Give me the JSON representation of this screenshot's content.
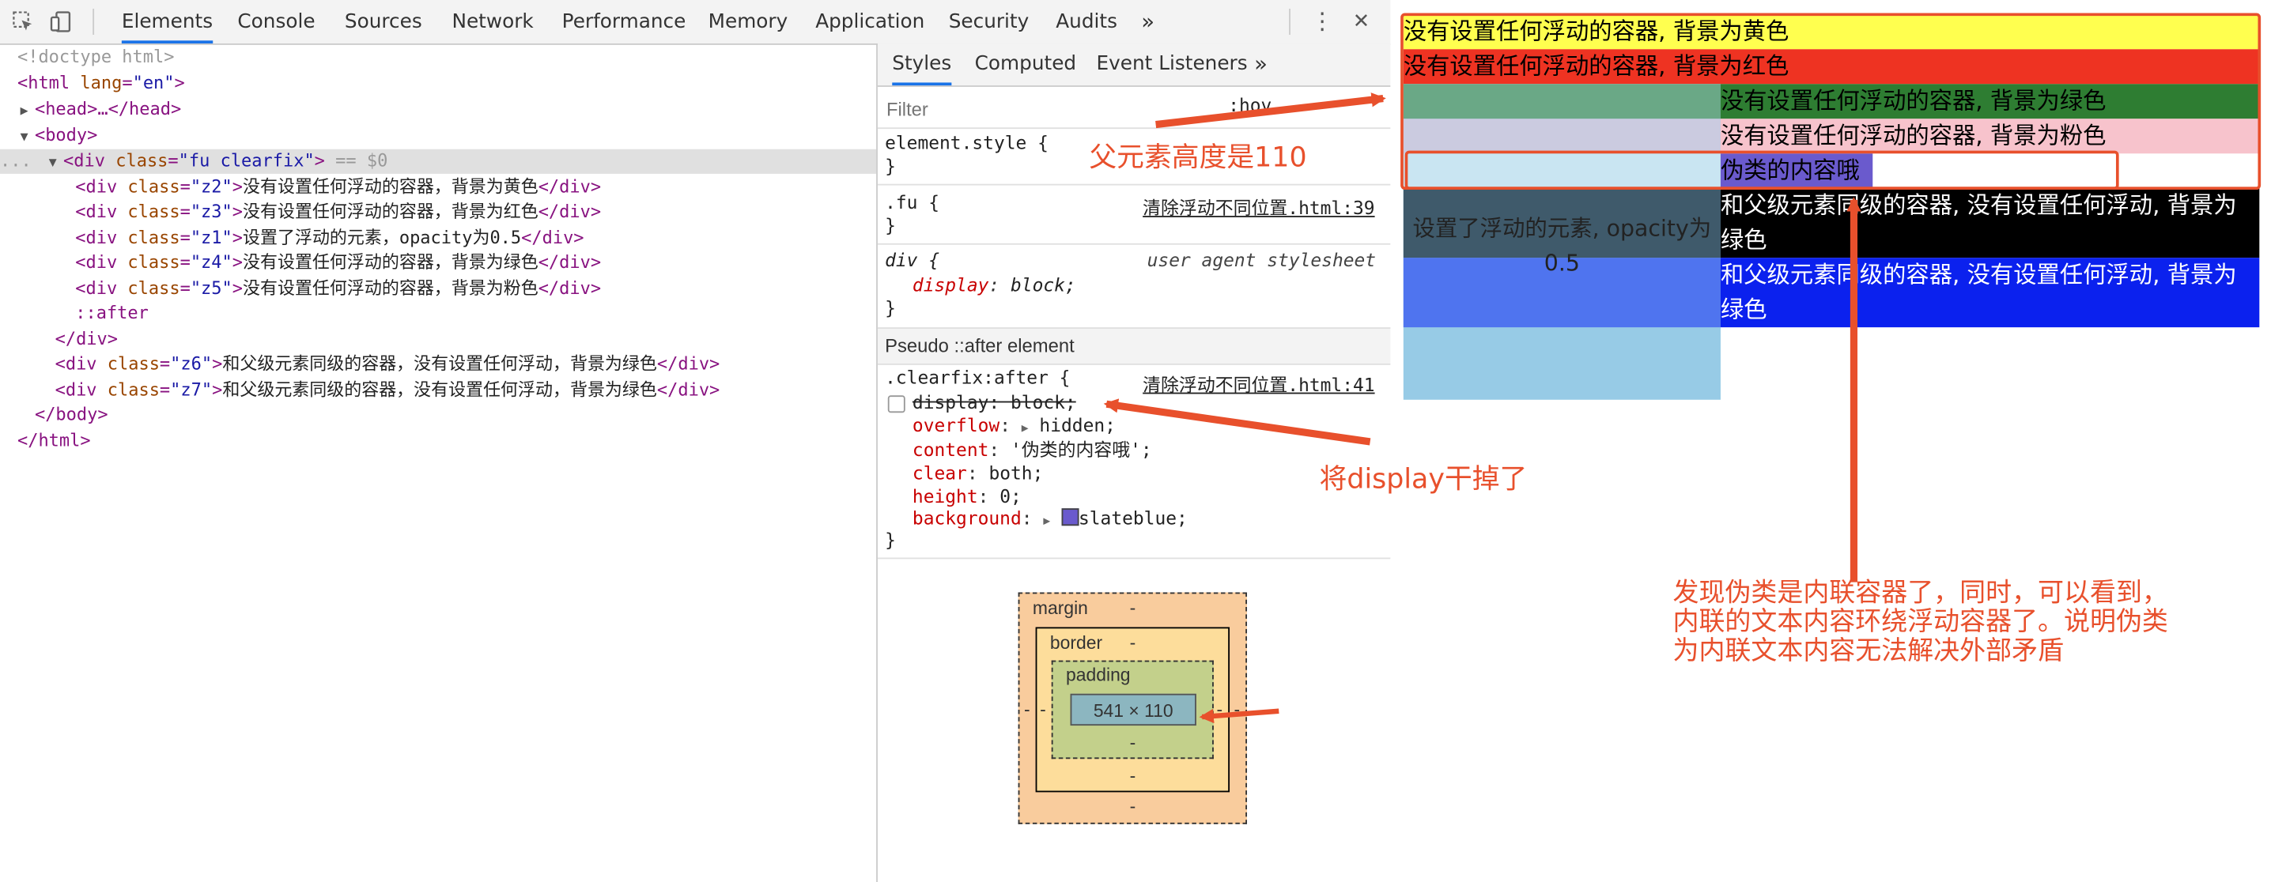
{
  "toolbar": {
    "tabs": [
      "Elements",
      "Console",
      "Sources",
      "Network",
      "Performance",
      "Memory",
      "Application",
      "Security",
      "Audits"
    ],
    "more": "»",
    "menu": "⋮",
    "close": "✕"
  },
  "dom": {
    "doctype": "<!doctype html>",
    "html_open": "<html lang=\"en\">",
    "head": "<head>…</head>",
    "body_open": "<body>",
    "fu_tag": "div",
    "fu_attr": "class",
    "fu_val": "\"fu clearfix\"",
    "fu_marker": "== $0",
    "children": [
      {
        "cls": "\"z2\"",
        "text": "没有设置任何浮动的容器，背景为黄色"
      },
      {
        "cls": "\"z3\"",
        "text": "没有设置任何浮动的容器，背景为红色"
      },
      {
        "cls": "\"z1\"",
        "text": "设置了浮动的元素，opacity为0.5"
      },
      {
        "cls": "\"z4\"",
        "text": "没有设置任何浮动的容器，背景为绿色"
      },
      {
        "cls": "\"z5\"",
        "text": "没有设置任何浮动的容器，背景为粉色"
      }
    ],
    "after": "::after",
    "div_close": "</div>",
    "siblings": [
      {
        "cls": "\"z6\"",
        "text": "和父级元素同级的容器，没有设置任何浮动，背景为绿色"
      },
      {
        "cls": "\"z7\"",
        "text": "和父级元素同级的容器，没有设置任何浮动，背景为绿色"
      }
    ],
    "body_close": "</body>",
    "html_close": "</html>",
    "ellipsis": "..."
  },
  "styles": {
    "tabs": [
      "Styles",
      "Computed",
      "Event Listeners"
    ],
    "more": "»",
    "filter_placeholder": "Filter",
    "hov": ":hov",
    "element_style": "element.style {",
    "close_brace": "}",
    "fu_selector": ".fu {",
    "fu_src": "清除浮动不同位置.html:39",
    "div_selector": "div {",
    "ua": "user agent stylesheet",
    "display_prop": "display",
    "display_val": "block;",
    "pseudo_header": "Pseudo ::after element",
    "clearfix_selector": ".clearfix:after {",
    "clearfix_src": "清除浮动不同位置.html:41",
    "props": [
      {
        "name": "display",
        "value": "block;",
        "struck": true
      },
      {
        "name": "overflow",
        "value": "hidden;"
      },
      {
        "name": "content",
        "value": "'伪类的内容哦';"
      },
      {
        "name": "clear",
        "value": "both;"
      },
      {
        "name": "height",
        "value": "0;"
      },
      {
        "name": "background",
        "value": "slateblue;"
      }
    ],
    "slateblue": "#6a5acd"
  },
  "box_model": {
    "margin_label": "margin",
    "border_label": "border",
    "padding_label": "padding",
    "dash": "-",
    "content_size": "541 × 110"
  },
  "render": {
    "z2": "没有设置任何浮动的容器, 背景为黄色",
    "z3": "没有设置任何浮动的容器, 背景为红色",
    "z4": "没有设置任何浮动的容器, 背景为绿色",
    "z5": "没有设置任何浮动的容器, 背景为粉色",
    "after": "伪类的内容哦",
    "z1": "设置了浮动的元素, opacity为0.5",
    "z6": "和父级元素同级的容器, 没有设置任何浮动, 背景为绿色",
    "z7": "和父级元素同级的容器, 没有设置任何浮动, 背景为绿色",
    "colors": {
      "yellow": "#ffff4f",
      "red": "#ee3322",
      "green": "#2e7d32",
      "pink": "#f7c3cc",
      "black": "#000000",
      "blue": "#0b21ee",
      "float": "#97cbe6",
      "slateblue": "#6a5acd"
    }
  },
  "annotations": {
    "parent_height": "父元素高度是110",
    "display_removed": "将display干掉了",
    "conclusion_1": "发现伪类是内联容器了，同时，可以看到，",
    "conclusion_2": "内联的文本内容环绕浮动容器了。说明伪类",
    "conclusion_3": "为内联文本内容无法解决外部矛盾"
  }
}
